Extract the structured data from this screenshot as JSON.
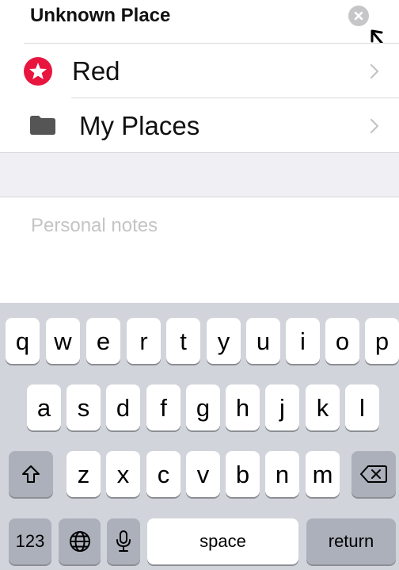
{
  "place": {
    "name_value": "Unknown Place"
  },
  "rows": [
    {
      "label": "Red",
      "icon": "red-star-badge-icon",
      "icon_color": "#e8153f"
    },
    {
      "label": "My Places",
      "icon": "folder-icon",
      "icon_color": "#555555"
    }
  ],
  "notes": {
    "placeholder": "Personal notes"
  },
  "keyboard": {
    "row1": [
      "q",
      "w",
      "e",
      "r",
      "t",
      "y",
      "u",
      "i",
      "o",
      "p"
    ],
    "row2": [
      "a",
      "s",
      "d",
      "f",
      "g",
      "h",
      "j",
      "k",
      "l"
    ],
    "row3": [
      "z",
      "x",
      "c",
      "v",
      "b",
      "n",
      "m"
    ],
    "numbers_label": "123",
    "space_label": "space",
    "return_label": "return"
  },
  "colors": {
    "keyboard_bg": "#d1d4da",
    "accent_red": "#e8153f"
  }
}
